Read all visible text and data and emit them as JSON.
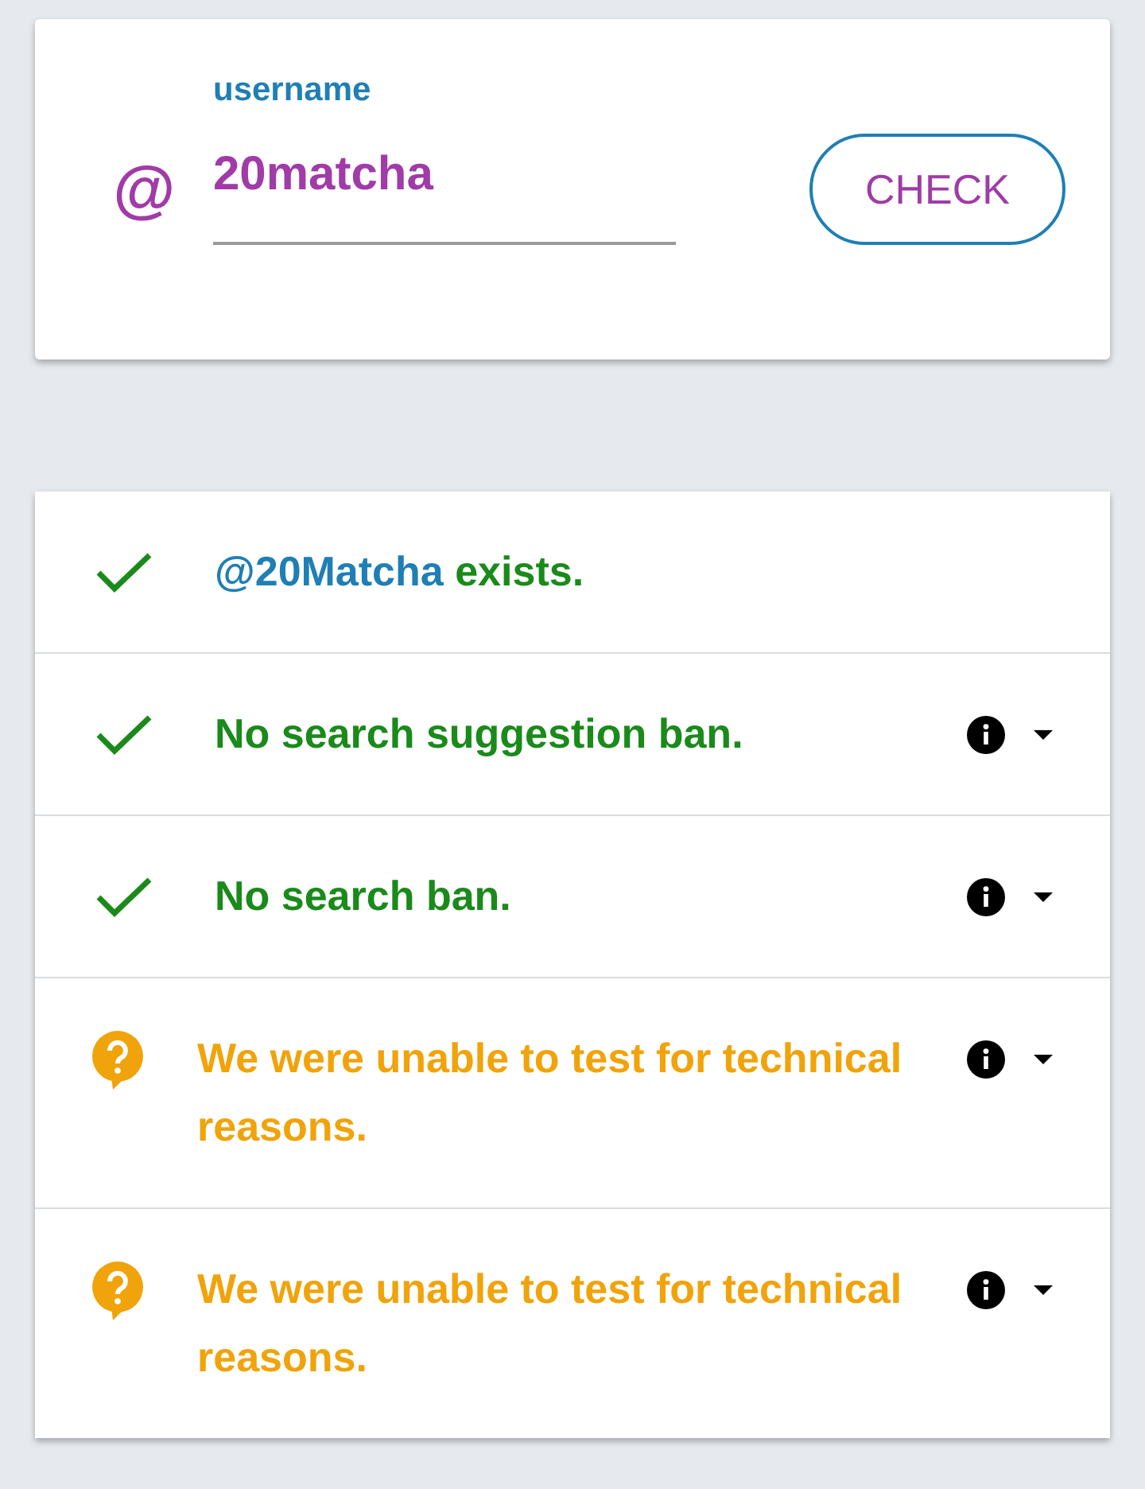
{
  "search_card": {
    "prefix": "@",
    "field": {
      "label": "username",
      "value": "20matcha"
    },
    "check_button": {
      "label": "CHECK"
    }
  },
  "results": [
    {
      "kind": "pass",
      "link": "@20Matcha",
      "text": "exists."
    },
    {
      "kind": "pass",
      "text": "No search suggestion ban.",
      "toggle": {
        "expanded": false
      }
    },
    {
      "kind": "pass",
      "text": "No search ban.",
      "toggle": {
        "expanded": false
      }
    },
    {
      "kind": "unknown",
      "text": "We were unable to test for technical reasons.",
      "toggle": {
        "expanded": false
      }
    },
    {
      "kind": "unknown",
      "text": "We were unable to test for technical reasons.",
      "toggle": {
        "expanded": false
      }
    }
  ]
}
